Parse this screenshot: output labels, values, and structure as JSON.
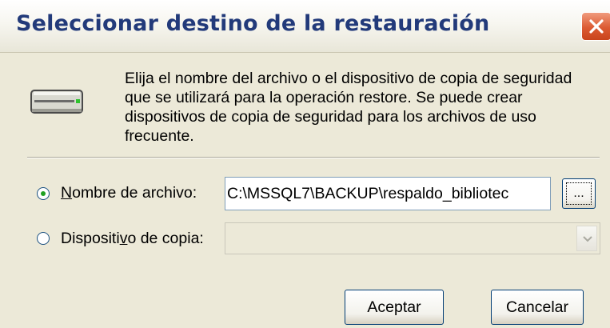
{
  "window": {
    "title": "Seleccionar destino de la restauración",
    "close_icon": "close-icon"
  },
  "header": {
    "icon": "backup-device-icon",
    "description": "Elija el nombre del archivo o el dispositivo de copia de seguridad que se utilizará para la operación restore. Se puede crear dispositivos de copia de seguridad para los archivos de uso frecuente."
  },
  "options": {
    "file": {
      "label_accel": "N",
      "label_rest": "ombre de archivo:",
      "selected": true,
      "value": "C:\\MSSQL7\\BACKUP\\respaldo_bibliotec",
      "browse_label": "..."
    },
    "device": {
      "label_pre": "Dispositi",
      "label_accel": "v",
      "label_post": "o de copia:",
      "selected": false,
      "value": ""
    }
  },
  "buttons": {
    "ok": "Aceptar",
    "cancel": "Cancelar"
  },
  "colors": {
    "title_text": "#223a7a",
    "close_button": "#dc5a32",
    "dialog_bg": "#ece9d8",
    "radio_dot": "#21a121",
    "button_border": "#003c74"
  }
}
